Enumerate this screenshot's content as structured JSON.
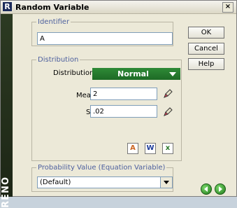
{
  "window": {
    "title": "Random Variable",
    "brand": "RENO"
  },
  "identifier": {
    "legend": "Identifier",
    "value": "A"
  },
  "distribution": {
    "legend": "Distribution",
    "label": "Distribution",
    "selected": "Normal",
    "mean_label": "Mean",
    "mean_value": "2",
    "std_label": "Std",
    "std_value": ".02"
  },
  "probability": {
    "legend": "Probability Value (Equation Variable)",
    "selected": "(Default)"
  },
  "buttons": {
    "ok": "OK",
    "cancel": "Cancel",
    "help": "Help"
  },
  "tools": {
    "a": "A",
    "w": "W",
    "x": "x"
  },
  "icons": [
    "app-icon",
    "close-icon",
    "pencil-icon",
    "chevron-down-icon",
    "arrow-left-icon",
    "arrow-right-icon"
  ]
}
